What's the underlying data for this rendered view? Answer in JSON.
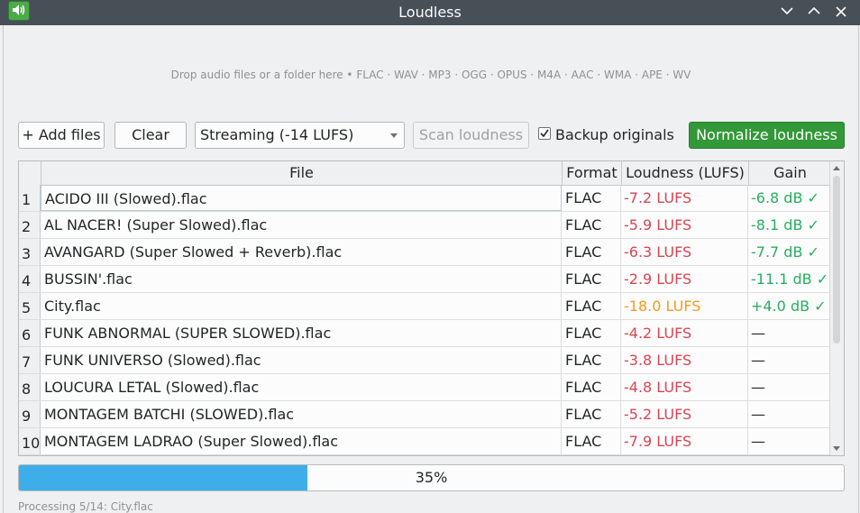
{
  "window": {
    "title": "Loudless"
  },
  "dropzone": {
    "text": "Drop audio files or a folder here  •  FLAC · WAV · MP3 · OGG · OPUS · M4A · AAC · WMA · APE · WV"
  },
  "toolbar": {
    "add_files": "+ Add files",
    "clear": "Clear",
    "target_preset": "Streaming (-14 LUFS)",
    "scan": "Scan loudness",
    "backup_label": "Backup originals",
    "backup_checked": true,
    "normalize": "Normalize loudness"
  },
  "table": {
    "headers": {
      "file": "File",
      "format": "Format",
      "loudness": "Loudness (LUFS)",
      "gain": "Gain"
    },
    "rows": [
      {
        "num": "1",
        "file": "ACIDO III (Slowed).flac",
        "format": "FLAC",
        "loudness": "-7.2 LUFS",
        "loudness_color": "#da4453",
        "gain": "-6.8 dB ✓",
        "gain_color": "#27ae60"
      },
      {
        "num": "2",
        "file": "AL NACER! (Super Slowed).flac",
        "format": "FLAC",
        "loudness": "-5.9 LUFS",
        "loudness_color": "#da4453",
        "gain": "-8.1 dB ✓",
        "gain_color": "#27ae60"
      },
      {
        "num": "3",
        "file": "AVANGARD (Super Slowed + Reverb).flac",
        "format": "FLAC",
        "loudness": "-6.3 LUFS",
        "loudness_color": "#da4453",
        "gain": "-7.7 dB ✓",
        "gain_color": "#27ae60"
      },
      {
        "num": "4",
        "file": "BUSSIN'.flac",
        "format": "FLAC",
        "loudness": "-2.9 LUFS",
        "loudness_color": "#da4453",
        "gain": "-11.1 dB ✓",
        "gain_color": "#27ae60"
      },
      {
        "num": "5",
        "file": "City.flac",
        "format": "FLAC",
        "loudness": "-18.0 LUFS",
        "loudness_color": "#f39c1f",
        "gain": "+4.0 dB ✓",
        "gain_color": "#27ae60"
      },
      {
        "num": "6",
        "file": "FUNK ABNORMAL (SUPER SLOWED).flac",
        "format": "FLAC",
        "loudness": "-4.2 LUFS",
        "loudness_color": "#da4453",
        "gain": "—",
        "gain_color": "#232627"
      },
      {
        "num": "7",
        "file": "FUNK UNIVERSO (Slowed).flac",
        "format": "FLAC",
        "loudness": "-3.8 LUFS",
        "loudness_color": "#da4453",
        "gain": "—",
        "gain_color": "#232627"
      },
      {
        "num": "8",
        "file": "LOUCURA LETAL (Slowed).flac",
        "format": "FLAC",
        "loudness": "-4.8 LUFS",
        "loudness_color": "#da4453",
        "gain": "—",
        "gain_color": "#232627"
      },
      {
        "num": "9",
        "file": "MONTAGEM BATCHI (SLOWED).flac",
        "format": "FLAC",
        "loudness": "-5.2 LUFS",
        "loudness_color": "#da4453",
        "gain": "—",
        "gain_color": "#232627"
      },
      {
        "num": "10",
        "file": "MONTAGEM LADRAO (Super Slowed).flac",
        "format": "FLAC",
        "loudness": "-7.9 LUFS",
        "loudness_color": "#da4453",
        "gain": "—",
        "gain_color": "#232627"
      }
    ]
  },
  "progress": {
    "value": 35,
    "label": "35%"
  },
  "status": {
    "text": "Processing 5/14: City.flac"
  },
  "colors": {
    "titlebar": "#475057",
    "accent": "#3daee9",
    "primary_button": "#329838",
    "loud": "#da4453",
    "quiet": "#f39c1f",
    "ok": "#27ae60"
  },
  "icons": {
    "app": "speaker-icon",
    "minimize": "chevron-down-icon",
    "maximize": "chevron-up-icon",
    "close": "close-icon"
  }
}
